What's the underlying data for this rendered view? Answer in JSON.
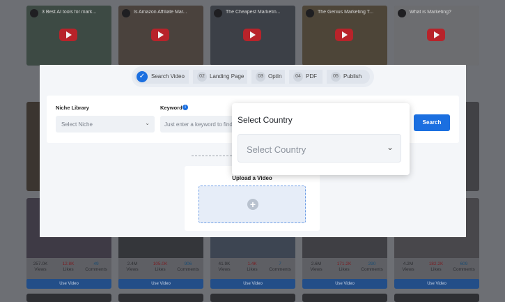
{
  "steps": [
    {
      "num": "✓",
      "label": "Search Video"
    },
    {
      "num": "02",
      "label": "Landing Page"
    },
    {
      "num": "03",
      "label": "OptIn"
    },
    {
      "num": "04",
      "label": "PDF"
    },
    {
      "num": "05",
      "label": "Publish"
    }
  ],
  "form": {
    "niche_label": "Niche Library",
    "niche_placeholder": "Select Niche",
    "keyword_label": "Keyword",
    "keyword_placeholder": "Just enter a keyword to find",
    "search_label": "Search"
  },
  "upload": {
    "title": "Upload a Video",
    "plus": "+"
  },
  "country_popover": {
    "title": "Select Country",
    "placeholder": "Select Country"
  },
  "video_cards_top": [
    {
      "title": "3 Best AI tools for mark..."
    },
    {
      "title": "Is Amazon Affiliate Mar..."
    },
    {
      "title": "The Cheapest Marketin..."
    },
    {
      "title": "The Genius Marketing T..."
    },
    {
      "title": "What is Marketing?"
    }
  ],
  "video_cards_bottom": [
    {
      "views": "257.0K",
      "likes": "12.8K",
      "comments": "49"
    },
    {
      "views": "2.4M",
      "likes": "105.0K",
      "comments": "906"
    },
    {
      "views": "41.9K",
      "likes": "1.4K",
      "comments": "7"
    },
    {
      "views": "2.6M",
      "likes": "171.2K",
      "comments": "290"
    },
    {
      "views": "4.2M",
      "likes": "182.2K",
      "comments": "609"
    }
  ],
  "card_labels": {
    "views": "Views",
    "likes": "Likes",
    "comments": "Comments",
    "use_video": "Use Video"
  }
}
